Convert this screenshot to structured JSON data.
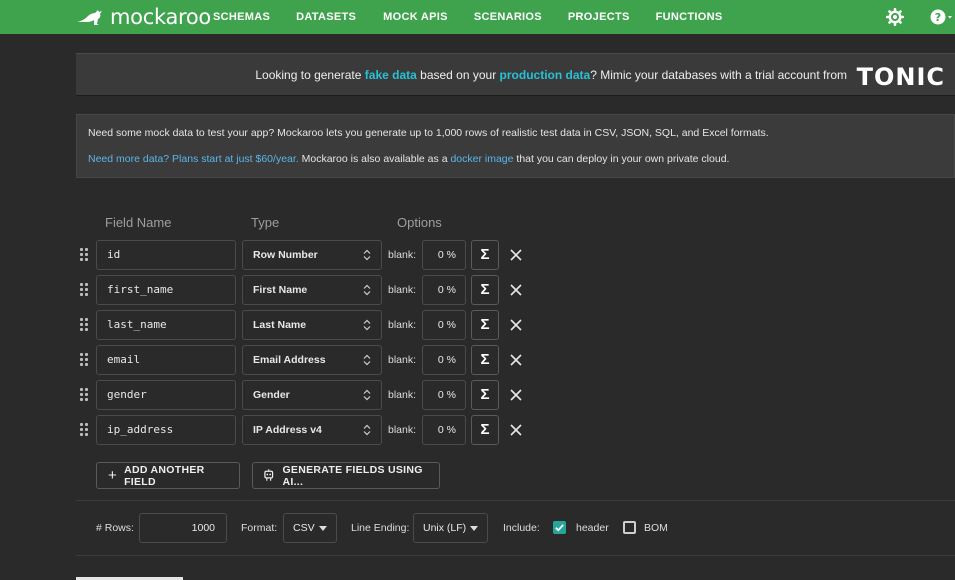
{
  "app": {
    "logo_text": "mockaroo",
    "nav": [
      "SCHEMAS",
      "DATASETS",
      "MOCK APIS",
      "SCENARIOS",
      "PROJECTS",
      "FUNCTIONS"
    ],
    "colors": {
      "brand_green": "#3fa34d",
      "highlight_cyan": "#27c2d6",
      "link_blue": "#5bb5e8",
      "checkbox_teal": "#26a69a"
    },
    "icons": {
      "settings": "gear-icon",
      "help": "help-icon"
    }
  },
  "banner": {
    "t1": "Looking to generate ",
    "h1": "fake data",
    "t2": " based on your ",
    "h2": "production data",
    "t3": "? Mimic your databases with a trial account from",
    "brand": "TONIC"
  },
  "info": {
    "line1": "Need some mock data to test your app? Mockaroo lets you generate up to 1,000 rows of realistic test data in CSV, JSON, SQL, and Excel formats.",
    "link1": "Need more data? Plans start at just $60/year.",
    "t2": " Mockaroo is also available as a ",
    "link2": "docker image",
    "t3": " that you can deploy in your own private cloud."
  },
  "table": {
    "headers": {
      "field_name": "Field Name",
      "type": "Type",
      "options": "Options"
    },
    "blank_label": "blank:",
    "sigma": "Σ",
    "rows": [
      {
        "name": "id",
        "type": "Row Number",
        "blank": "0 %"
      },
      {
        "name": "first_name",
        "type": "First Name",
        "blank": "0 %"
      },
      {
        "name": "last_name",
        "type": "Last Name",
        "blank": "0 %"
      },
      {
        "name": "email",
        "type": "Email Address",
        "blank": "0 %"
      },
      {
        "name": "gender",
        "type": "Gender",
        "blank": "0 %"
      },
      {
        "name": "ip_address",
        "type": "IP Address v4",
        "blank": "0 %"
      }
    ]
  },
  "actions": {
    "add_field": "ADD ANOTHER FIELD",
    "generate_ai": "GENERATE FIELDS USING AI..."
  },
  "options": {
    "rows_label": "# Rows:",
    "rows_value": "1000",
    "format_label": "Format:",
    "format_value": "CSV",
    "line_ending_label": "Line Ending:",
    "line_ending_value": "Unix (LF)",
    "include_label": "Include:",
    "header_label": "header",
    "header_checked": true,
    "bom_label": "BOM",
    "bom_checked": false
  }
}
